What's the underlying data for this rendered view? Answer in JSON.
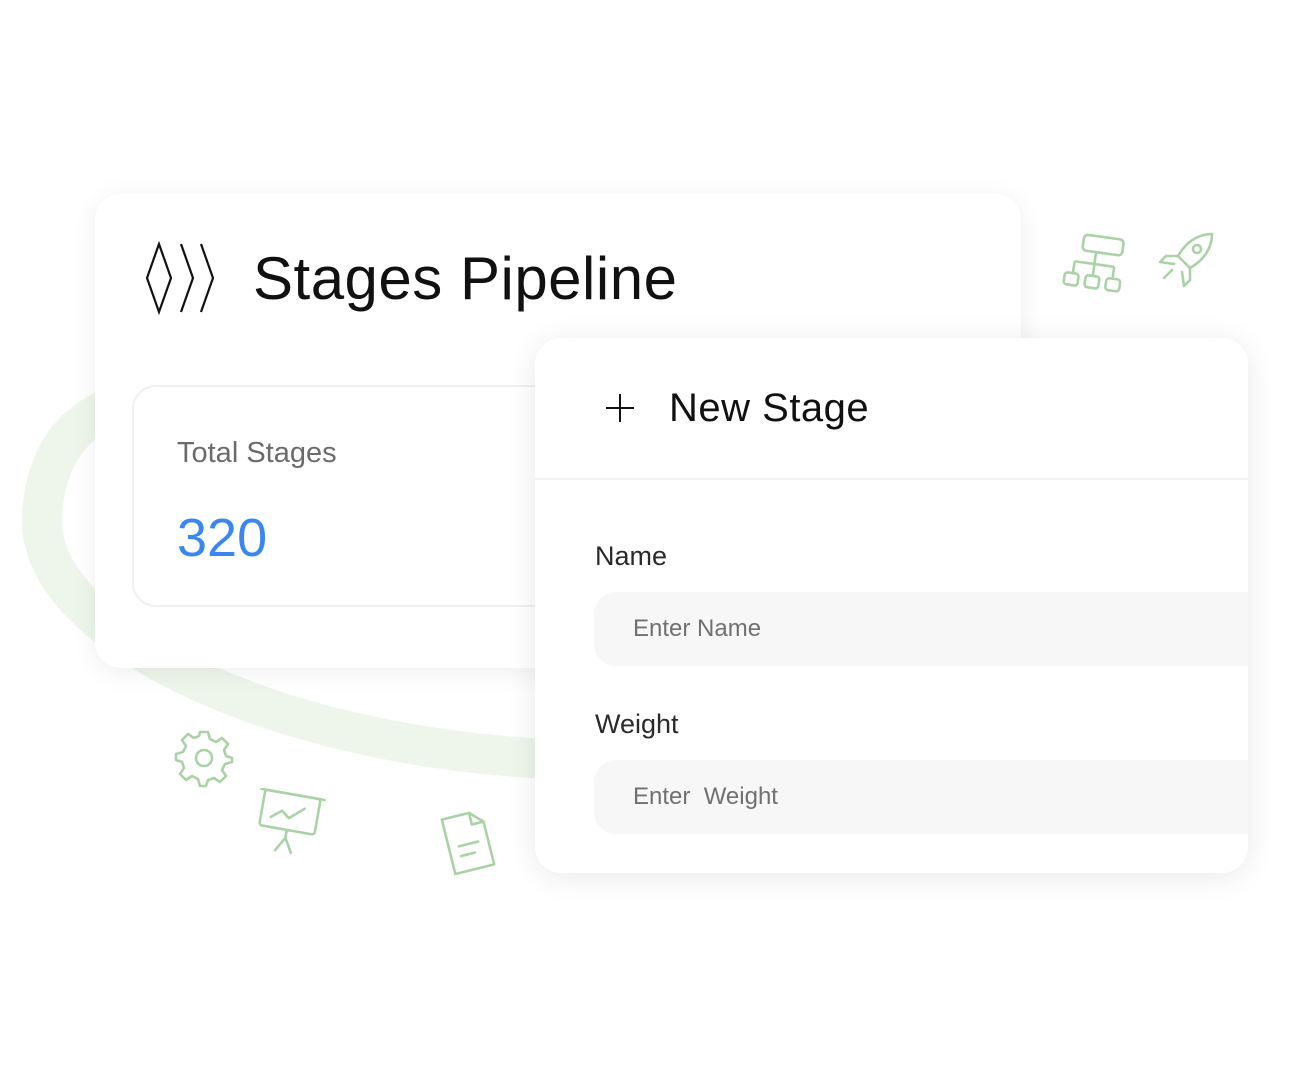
{
  "pipeline": {
    "title": "Stages Pipeline",
    "logo_icon": "stages-chevron-logo"
  },
  "stat": {
    "label": "Total Stages",
    "value": "320",
    "value_color": "#3b87f0"
  },
  "new_stage": {
    "title": "New Stage",
    "icon": "plus-icon",
    "fields": {
      "name": {
        "label": "Name",
        "placeholder": "Enter Name",
        "value": ""
      },
      "weight": {
        "label": "Weight",
        "placeholder": "Enter  Weight",
        "value": ""
      }
    }
  },
  "decorations": {
    "accent_color": "#a9d3a5",
    "ring_color": "#eef6ec",
    "icons": [
      "sitemap-icon",
      "rocket-icon",
      "gear-icon",
      "presentation-chart-icon",
      "document-icon"
    ]
  }
}
